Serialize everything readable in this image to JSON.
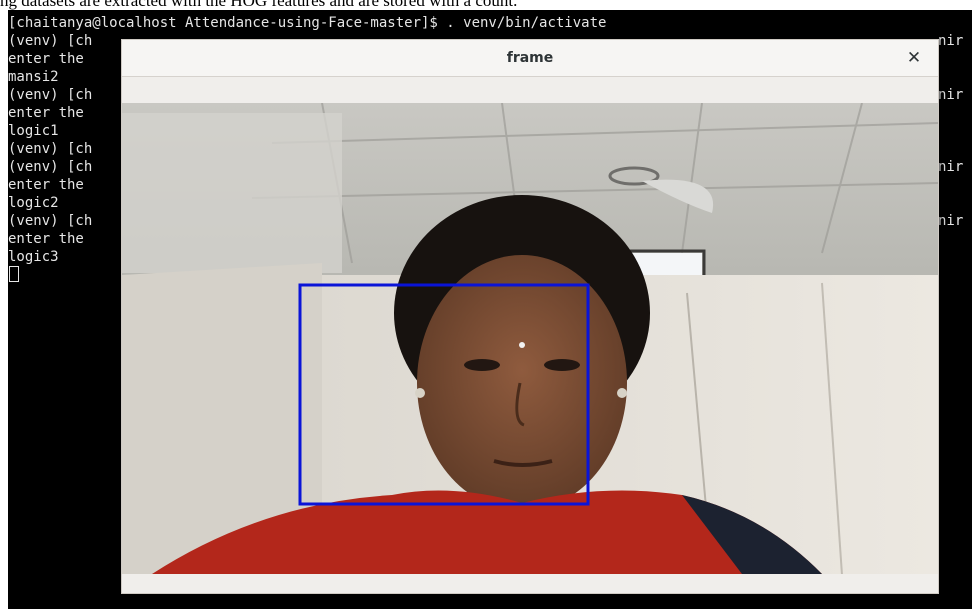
{
  "document": {
    "caption": "ng datasets are extracted with the HOG features and are stored with a count."
  },
  "terminal": {
    "lines": [
      "[chaitanya@localhost Attendance-using-Face-master]$ . venv/bin/activate",
      "(venv) [ch",
      "enter the",
      "mansi2",
      "(venv) [ch",
      "enter the",
      "logic1",
      "(venv) [ch",
      "(venv) [ch",
      "enter the",
      "logic2",
      "(venv) [ch",
      "enter the",
      "logic3"
    ],
    "right_fragments": [
      "nir",
      "nir",
      "nir",
      "nir"
    ],
    "background_color": "#000000",
    "text_color": "#e6e6e6"
  },
  "frame_window": {
    "title": "frame",
    "close_icon": "close-icon",
    "detection_box_color": "#0a14d8"
  }
}
